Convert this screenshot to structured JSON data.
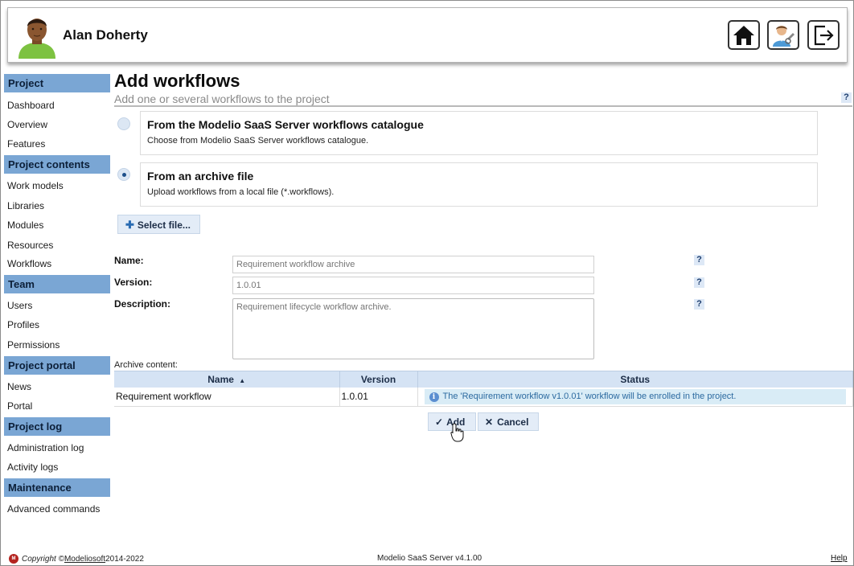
{
  "header": {
    "user_name": "Alan Doherty",
    "buttons": [
      {
        "name": "home",
        "icon": "home-icon"
      },
      {
        "name": "user-settings",
        "icon": "user-settings-icon"
      },
      {
        "name": "logout",
        "icon": "logout-icon"
      }
    ]
  },
  "sidebar": {
    "sections": [
      {
        "title": "Project",
        "items": [
          "Dashboard",
          "Overview",
          "Features"
        ]
      },
      {
        "title": "Project contents",
        "items": [
          "Work models",
          "Libraries",
          "Modules",
          "Resources",
          "Workflows"
        ]
      },
      {
        "title": "Team",
        "items": [
          "Users",
          "Profiles",
          "Permissions"
        ]
      },
      {
        "title": "Project portal",
        "items": [
          "News",
          "Portal"
        ]
      },
      {
        "title": "Project log",
        "items": [
          "Administration log",
          "Activity logs"
        ]
      },
      {
        "title": "Maintenance",
        "items": [
          "Advanced commands"
        ]
      }
    ]
  },
  "page": {
    "title": "Add workflows",
    "subtitle": "Add one or several workflows to the project",
    "help": "?"
  },
  "options": [
    {
      "title": "From the Modelio SaaS Server workflows catalogue",
      "description": "Choose from Modelio SaaS Server workflows catalogue.",
      "selected": false
    },
    {
      "title": "From an archive file",
      "description": "Upload workflows from a local file (*.workflows).",
      "selected": true
    }
  ],
  "select_file": {
    "label": "Select file..."
  },
  "form": {
    "name_label": "Name:",
    "name_placeholder": "Requirement workflow archive",
    "version_label": "Version:",
    "version_placeholder": "1.0.01",
    "description_label": "Description:",
    "description_placeholder": "Requirement lifecycle workflow archive.",
    "help": "?"
  },
  "archive": {
    "label": "Archive content:",
    "columns": {
      "name": "Name",
      "name_sort": "▲",
      "version": "Version",
      "status": "Status"
    },
    "rows": [
      {
        "name": "Requirement workflow",
        "version": "1.0.01",
        "status": "The 'Requirement workflow v1.0.01' workflow will be enrolled in the project."
      }
    ]
  },
  "actions": {
    "add": "Add",
    "cancel": "Cancel"
  },
  "footer": {
    "copyright_prefix": "Copyright ©",
    "company": "Modeliosoft",
    "years": " 2014-2022",
    "version": "Modelio SaaS Server v4.1.00",
    "help": "Help"
  },
  "colors": {
    "accent": "#7aa6d4",
    "button_bg": "#e3ecf7",
    "status_bg": "#d9ecf6"
  }
}
